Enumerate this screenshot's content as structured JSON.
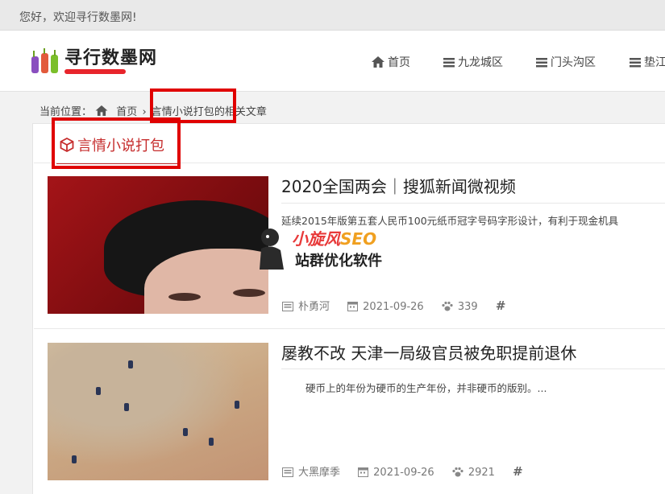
{
  "topbar": {
    "welcome": "您好，欢迎寻行数墨网!"
  },
  "site": {
    "logo_text": "寻行数墨网"
  },
  "nav": [
    {
      "label": "首页",
      "icon": "home-icon"
    },
    {
      "label": "九龙城区",
      "icon": "list-icon"
    },
    {
      "label": "门头沟区",
      "icon": "list-icon"
    },
    {
      "label": "垫江",
      "icon": "list-icon"
    }
  ],
  "breadcrumb": {
    "prefix": "当前位置：",
    "home": "首页",
    "current": "言情小说打包",
    "suffix": "的相关文章"
  },
  "tag": {
    "title": "言情小说打包",
    "icon": "cube-icon"
  },
  "articles": [
    {
      "title": "2020全国两会｜搜狐新闻微视频",
      "excerpt": "延续2015年版第五套人民币100元纸币冠字号码字形设计，有利于现金机具",
      "author": "朴勇河",
      "date": "2021-09-26",
      "views": "339",
      "tag_symbol": "#"
    },
    {
      "title": "屡教不改 天津一局级官员被免职提前退休",
      "excerpt": "硬币上的年份为硬币的生产年份，并非硬币的版别。...",
      "author": "大黑摩季",
      "date": "2021-09-26",
      "views": "2921",
      "tag_symbol": "#"
    }
  ],
  "watermark": {
    "brand": "小旋风",
    "brand_suffix": "SEO",
    "slogan": "站群优化软件"
  },
  "colors": {
    "accent": "#c62d2d",
    "annotation": "#e00000",
    "topbar": "#e9e9e9"
  }
}
